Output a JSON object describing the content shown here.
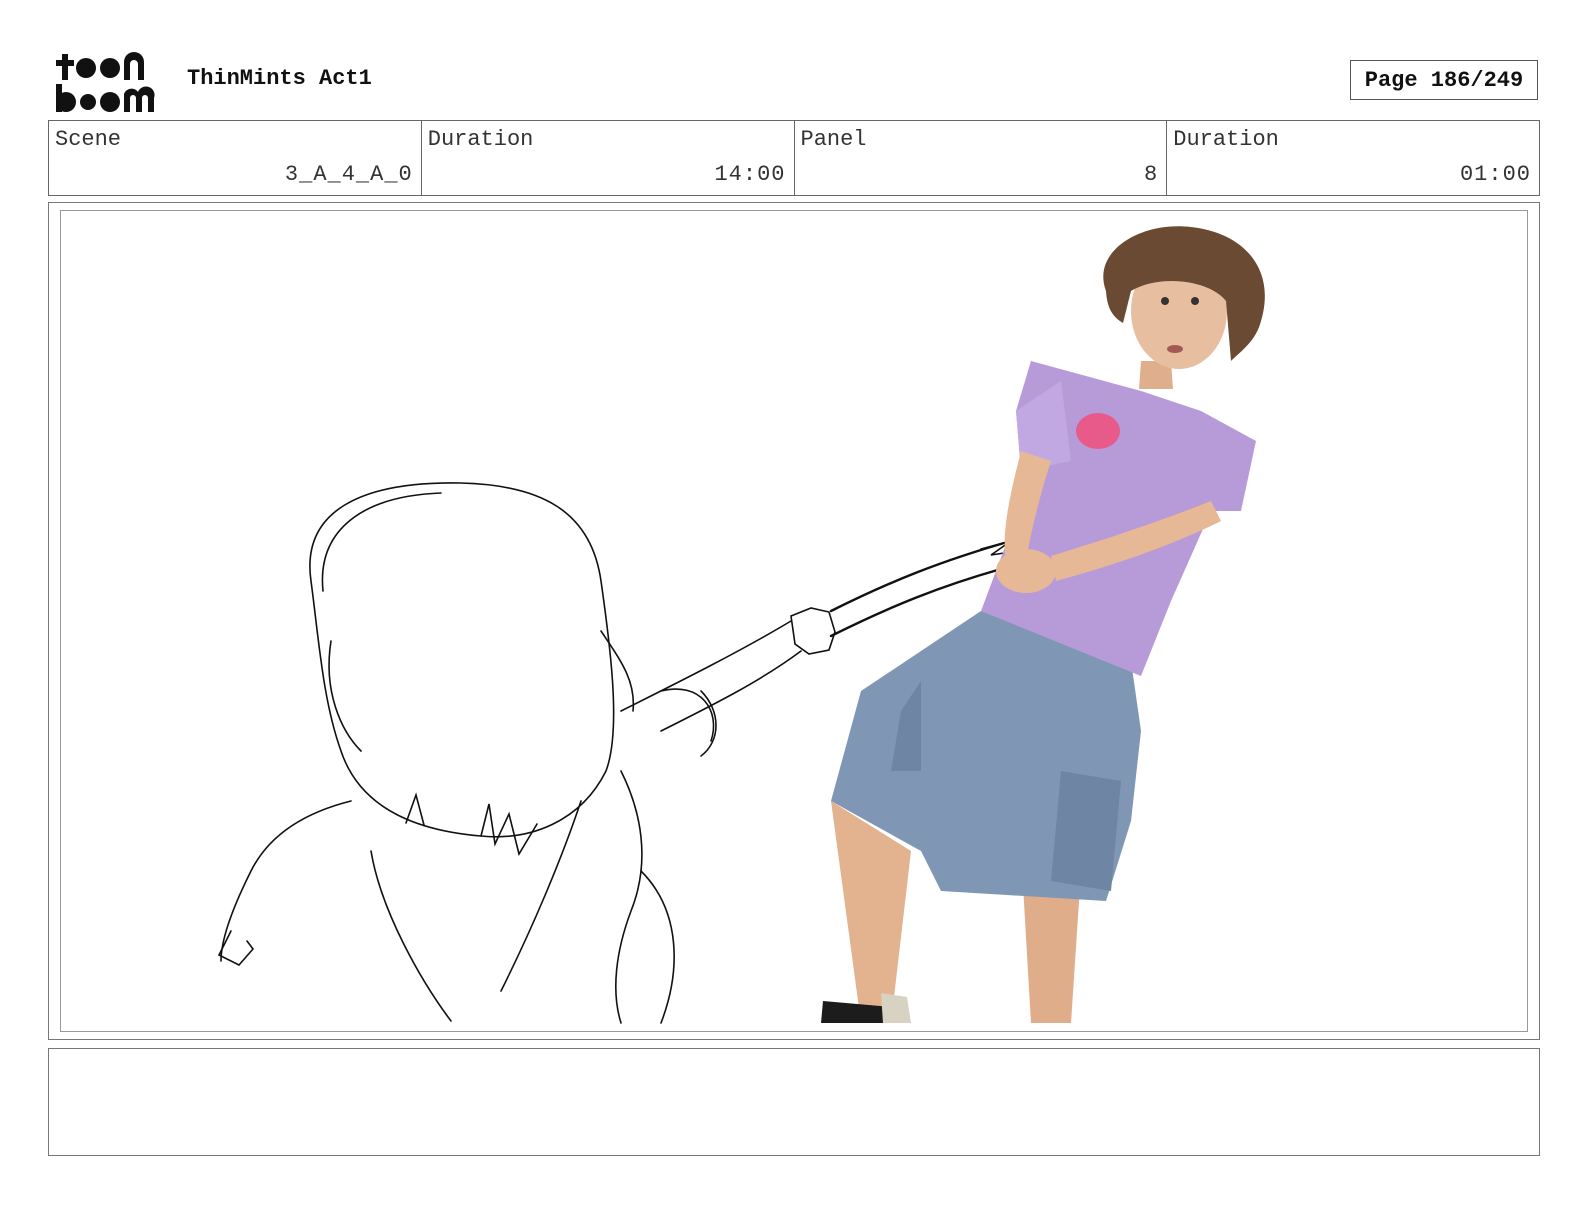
{
  "header": {
    "logo_text": "toon boom",
    "project_title": "ThinMints Act1",
    "page_label": "Page 186/249"
  },
  "info": {
    "scene_label": "Scene",
    "scene_value": "3_A_4_A_0",
    "scene_duration_label": "Duration",
    "scene_duration_value": "14:00",
    "panel_label": "Panel",
    "panel_value": "8",
    "panel_duration_label": "Duration",
    "panel_duration_value": "01:00"
  },
  "notes": {
    "text": ""
  },
  "colors": {
    "border": "#666666",
    "shirt": "#b79bd9",
    "shorts": "#7f97b4",
    "skin": "#e6b896",
    "hair": "#6b4a33"
  }
}
